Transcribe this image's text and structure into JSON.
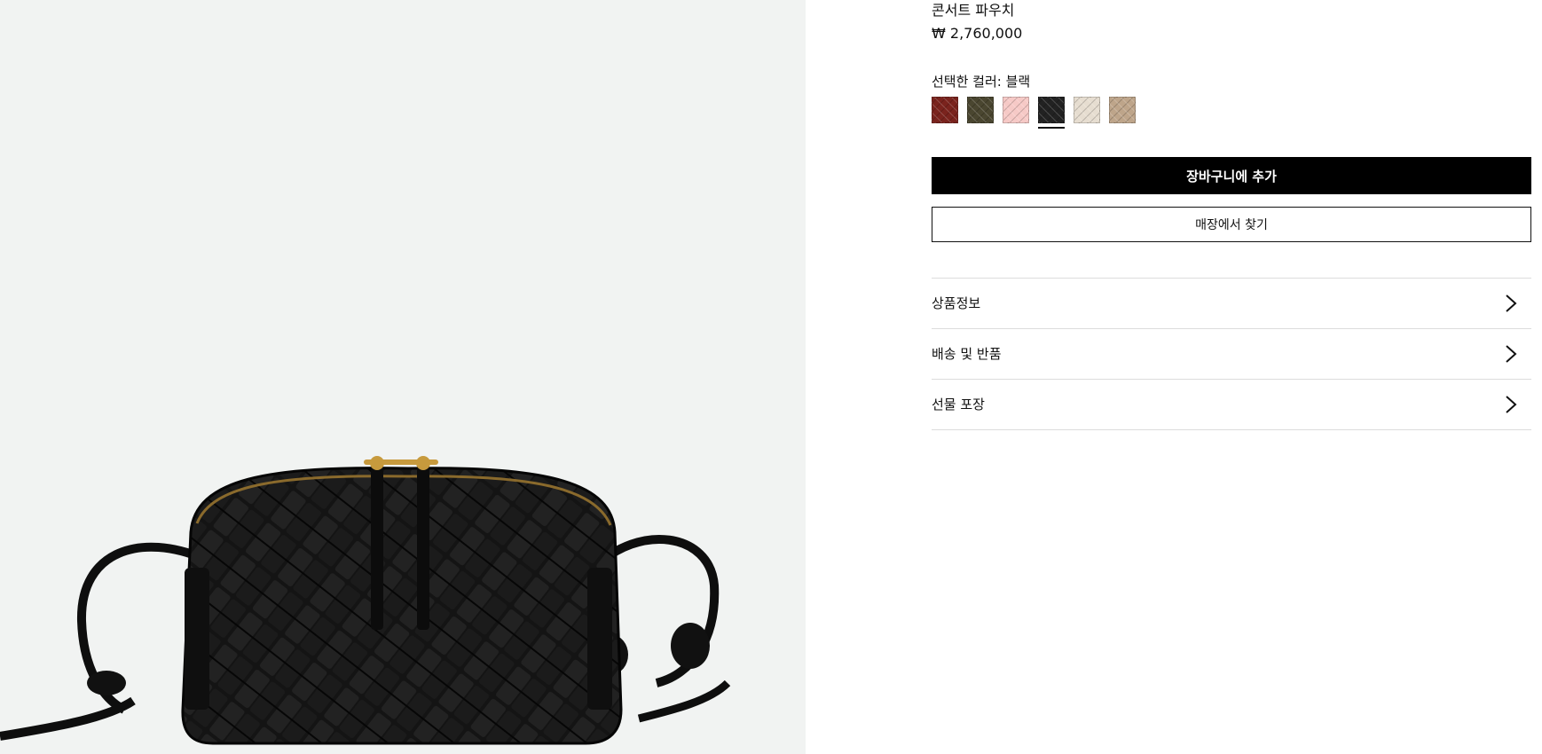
{
  "product": {
    "name": "콘서트 파우치",
    "price": "₩ 2,760,000",
    "image_alt": "black woven leather concert pouch"
  },
  "color_selector": {
    "label": "선택한 컬러: 블랙",
    "selected_index": 3,
    "swatches": [
      {
        "name": "red-swatch",
        "color": "#7a231d"
      },
      {
        "name": "olive-swatch",
        "color": "#4a4630"
      },
      {
        "name": "pink-swatch",
        "color": "#f6c9c6"
      },
      {
        "name": "black-swatch",
        "color": "#222222"
      },
      {
        "name": "cream-swatch",
        "color": "#e6ddd0"
      },
      {
        "name": "tan-swatch",
        "color": "#bea58a"
      }
    ]
  },
  "actions": {
    "add_to_cart": "장바구니에 추가",
    "find_in_store": "매장에서 찾기"
  },
  "accordion": [
    {
      "label": "상품정보",
      "icon": "chevron-right-icon"
    },
    {
      "label": "배송 및 반품",
      "icon": "chevron-right-icon"
    },
    {
      "label": "선물 포장",
      "icon": "chevron-right-icon"
    }
  ],
  "colors": {
    "image_background": "#f1f3f2",
    "primary_button": "#000000",
    "divider": "#dcdcdc"
  }
}
